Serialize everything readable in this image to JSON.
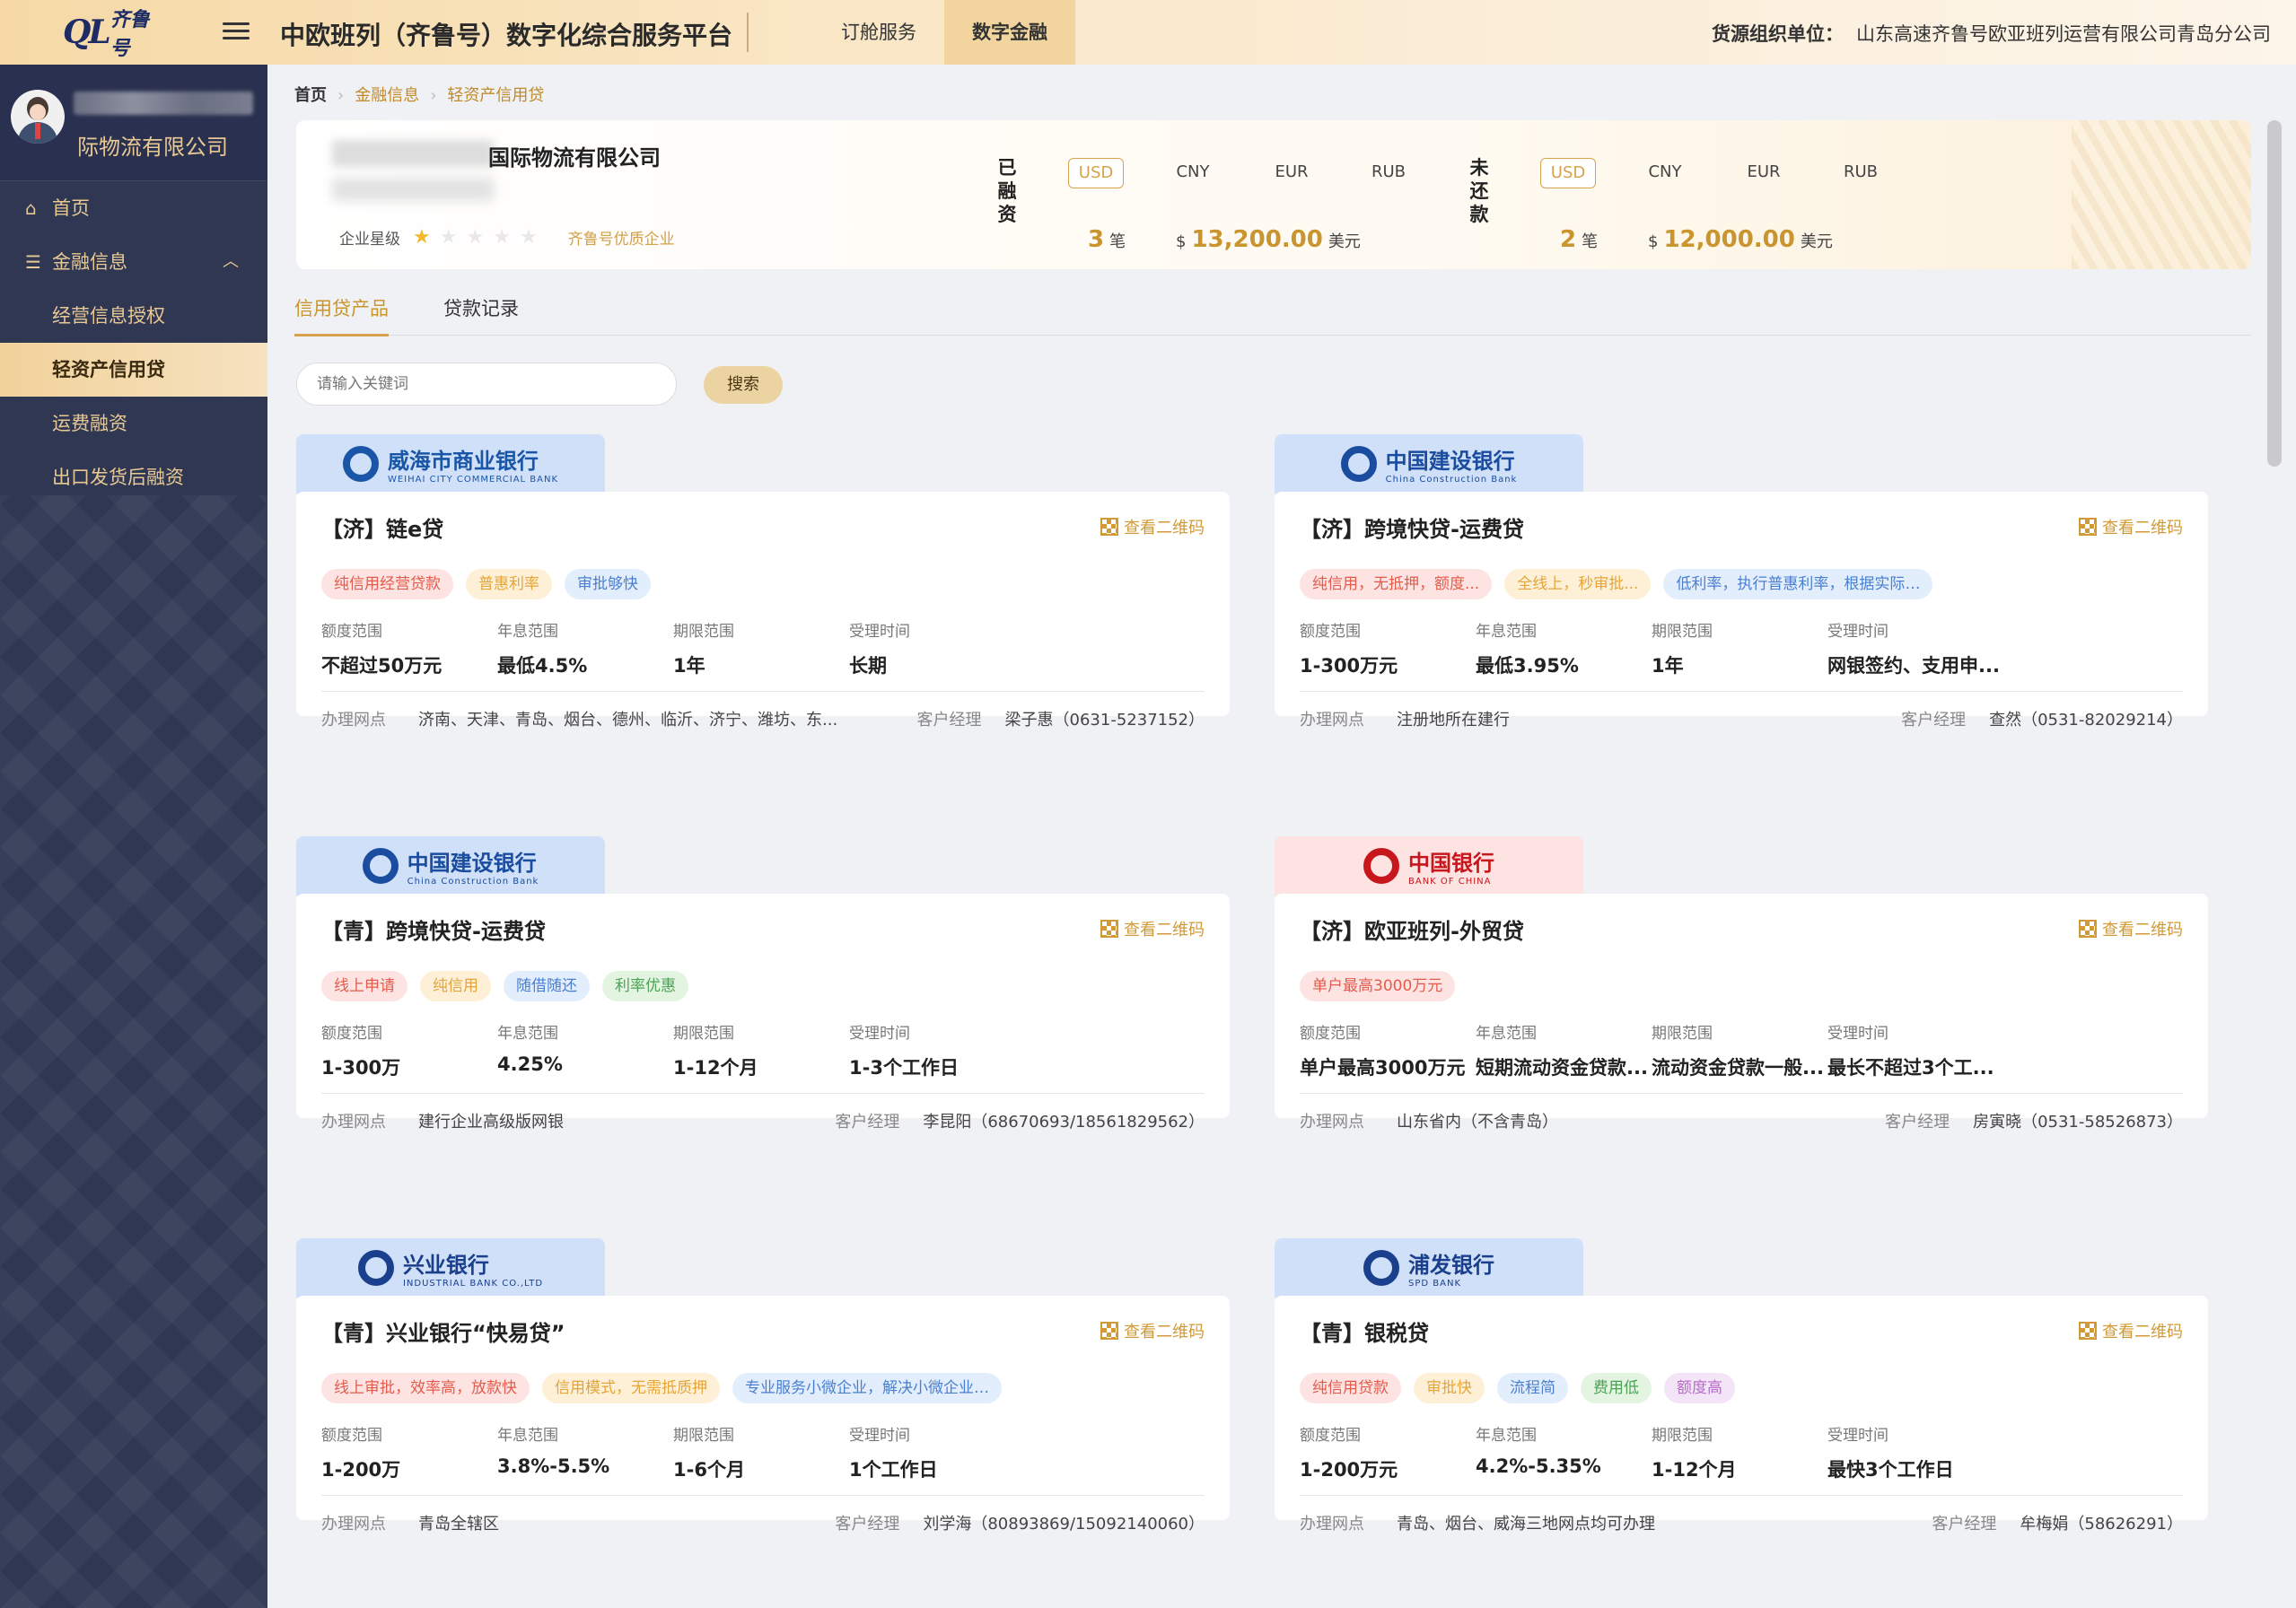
{
  "header": {
    "logo_ql": "QL",
    "logo_text": "齐鲁号",
    "platform_title": "中欧班列（齐鲁号）数字化综合服务平台",
    "tabs": [
      {
        "label": "订舱服务"
      },
      {
        "label": "数字金融"
      }
    ],
    "org_label": "货源组织单位：",
    "org_value": "山东高速齐鲁号欧亚班列运营有限公司青岛分公司"
  },
  "sidebar": {
    "company": "际物流有限公司",
    "items": [
      {
        "label": "首页",
        "icon": "home-icon"
      },
      {
        "label": "金融信息",
        "icon": "finance-icon"
      },
      {
        "label": "经营信息授权"
      },
      {
        "label": "轻资产信用贷"
      },
      {
        "label": "运费融资"
      },
      {
        "label": "出口发货后融资"
      }
    ]
  },
  "breadcrumb": [
    "首页",
    "金融信息",
    "轻资产信用贷"
  ],
  "company_banner": {
    "name_suffix": "际物流有限公司",
    "name_prefix": "国",
    "rating_label": "企业星级",
    "rating_value": 0.5,
    "rating_max": 5,
    "quality_badge": "齐鲁号优质企业",
    "financed": {
      "label": "已融资",
      "currencies": [
        "USD",
        "CNY",
        "EUR",
        "RUB"
      ],
      "active_currency": "USD",
      "count": "3",
      "count_unit": "笔",
      "amount_prefix": "$",
      "amount": "13,200.00",
      "amount_unit": "美元"
    },
    "outstanding": {
      "label": "未还款",
      "currencies": [
        "USD",
        "CNY",
        "EUR",
        "RUB"
      ],
      "active_currency": "USD",
      "count": "2",
      "count_unit": "笔",
      "amount_prefix": "$",
      "amount": "12,000.00",
      "amount_unit": "美元"
    }
  },
  "tabs": [
    {
      "label": "信用贷产品"
    },
    {
      "label": "贷款记录"
    }
  ],
  "search": {
    "placeholder": "请输入关键词",
    "button": "搜索"
  },
  "field_labels": [
    "额度范围",
    "年息范围",
    "期限范围",
    "受理时间"
  ],
  "footer_labels": {
    "branch": "办理网点",
    "manager": "客户经理"
  },
  "qr_label": "查看二维码",
  "products": [
    {
      "bank": "威海市商业银行",
      "bank_sub": "WEIHAI CITY COMMERCIAL BANK",
      "title": "【济】链e贷",
      "tags": [
        {
          "text": "纯信用经营贷款",
          "color": "red"
        },
        {
          "text": "普惠利率",
          "color": "orange"
        },
        {
          "text": "审批够快",
          "color": "blue"
        }
      ],
      "values": [
        "不超过50万元",
        "最低4.5%",
        "1年",
        "长期"
      ],
      "branch": "济南、天津、青岛、烟台、德州、临沂、济宁、潍坊、东...",
      "manager": "梁子惠（0631-5237152）"
    },
    {
      "bank": "中国建设银行",
      "bank_sub": "China Construction Bank",
      "title": "【济】跨境快贷-运费贷",
      "tags": [
        {
          "text": "纯信用，无抵押，额度...",
          "color": "red"
        },
        {
          "text": "全线上，秒审批...",
          "color": "orange"
        },
        {
          "text": "低利率，执行普惠利率，根据实际支用金额按日计息，...",
          "color": "blue"
        }
      ],
      "values": [
        "1-300万元",
        "最低3.95%",
        "1年",
        "网银签约、支用申..."
      ],
      "branch": "注册地所在建行",
      "manager": "查然（0531-82029214）"
    },
    {
      "bank": "中国建设银行",
      "bank_sub": "China Construction Bank",
      "title": "【青】跨境快贷-运费贷",
      "tags": [
        {
          "text": "线上申请",
          "color": "red"
        },
        {
          "text": "纯信用",
          "color": "orange"
        },
        {
          "text": "随借随还",
          "color": "blue"
        },
        {
          "text": "利率优惠",
          "color": "green"
        }
      ],
      "values": [
        "1-300万",
        "4.25%",
        "1-12个月",
        "1-3个工作日"
      ],
      "branch": "建行企业高级版网银",
      "manager": "李昆阳（68670693/18561829562）"
    },
    {
      "bank": "中国银行",
      "bank_sub": "BANK OF CHINA",
      "title": "【济】欧亚班列-外贸贷",
      "tags": [
        {
          "text": "单户最高3000万元",
          "color": "red"
        }
      ],
      "values": [
        "单户最高3000万元",
        "短期流动资金贷款...",
        "流动资金贷款一般...",
        "最长不超过3个工..."
      ],
      "branch": "山东省内（不含青岛）",
      "manager": "房寅晓（0531-58526873）"
    },
    {
      "bank": "兴业银行",
      "bank_sub": "INDUSTRIAL BANK CO.,LTD",
      "title": "【青】兴业银行“快易贷”",
      "tags": [
        {
          "text": "线上审批，效率高，放款快",
          "color": "red"
        },
        {
          "text": "信用模式，无需抵质押",
          "color": "orange"
        },
        {
          "text": "专业服务小微企业，解决小微企业融资难题",
          "color": "blue"
        }
      ],
      "values": [
        "1-200万",
        "3.8%-5.5%",
        "1-6个月",
        "1个工作日"
      ],
      "branch": "青岛全辖区",
      "manager": "刘学海（80893869/15092140060）"
    },
    {
      "bank": "浦发银行",
      "bank_sub": "SPD BANK",
      "title": "【青】银税贷",
      "tags": [
        {
          "text": "纯信用贷款",
          "color": "red"
        },
        {
          "text": "审批快",
          "color": "orange"
        },
        {
          "text": "流程简",
          "color": "blue"
        },
        {
          "text": "费用低",
          "color": "green"
        },
        {
          "text": "额度高",
          "color": "purple"
        }
      ],
      "values": [
        "1-200万元",
        "4.2%-5.35%",
        "1-12个月",
        "最快3个工作日"
      ],
      "branch": "青岛、烟台、威海三地网点均可办理",
      "manager": "牟梅娟（58626291）"
    }
  ]
}
